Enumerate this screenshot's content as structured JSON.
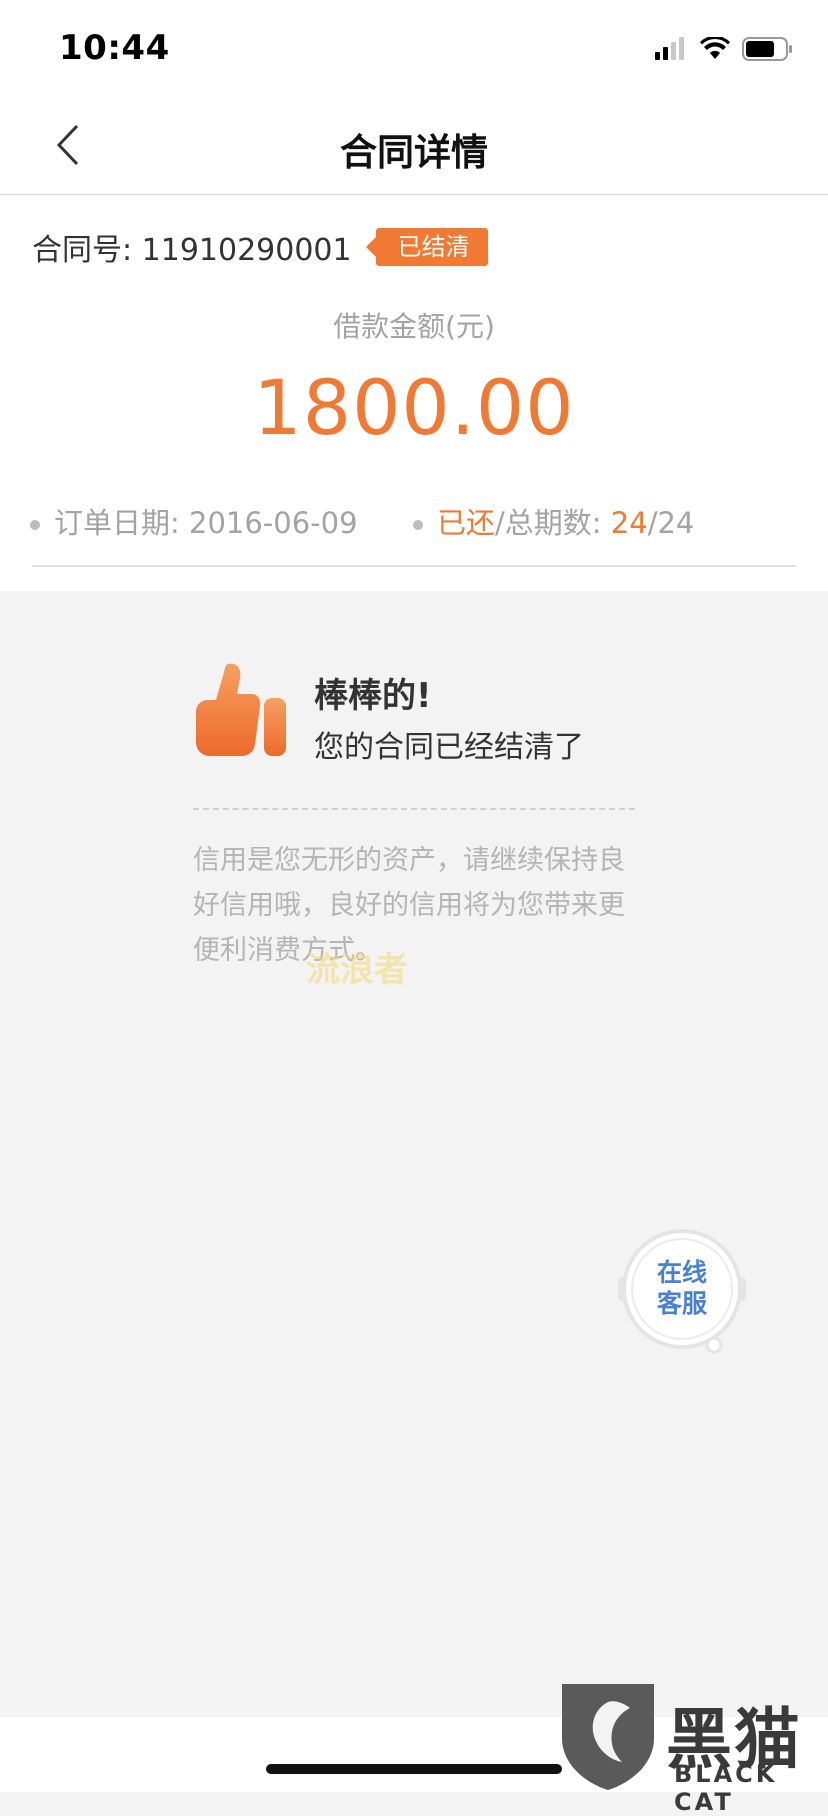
{
  "status_bar": {
    "time": "10:44"
  },
  "nav": {
    "title": "合同详情"
  },
  "contract": {
    "number_label": "合同号: 11910290001",
    "status_badge": "已结清",
    "amount_label": "借款金额(元)",
    "amount": "1800.00",
    "order_date": "订单日期: 2016-06-09",
    "repaid_label": "已还",
    "total_periods_label": "/总期数: ",
    "repaid_count": "24",
    "total_count": "/24"
  },
  "success": {
    "title": "棒棒的!",
    "subtitle": "您的合同已经结清了",
    "note": "信用是您无形的资产，请继续保持良好信用哦，良好的信用将为您带来更便利消费方式。",
    "overlay_text": "流浪者"
  },
  "customer_service": {
    "label": "在线客服"
  },
  "watermark": {
    "zh": "黑猫",
    "en": "BLACK CAT"
  },
  "colors": {
    "accent": "#f07a33",
    "link": "#4a7fd6",
    "background": "#f3f3f3"
  }
}
